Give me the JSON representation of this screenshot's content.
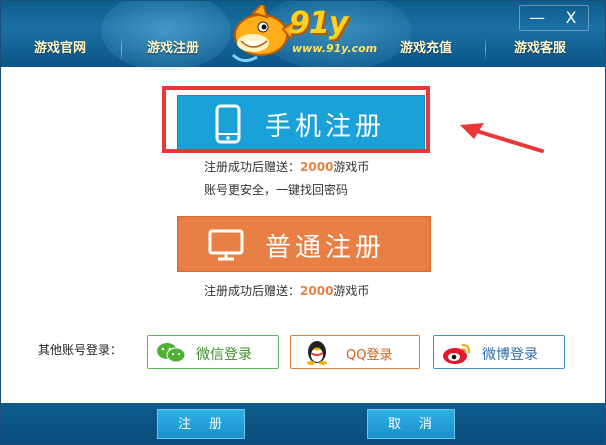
{
  "nav": {
    "items": [
      "游戏官网",
      "游戏注册",
      "游戏充值",
      "游戏客服"
    ]
  },
  "logo": {
    "text": "91y",
    "url": "www.91y.com"
  },
  "window": {
    "minimize": "—",
    "close": "X"
  },
  "register_phone": {
    "label": "手机注册",
    "icon": "smartphone-icon"
  },
  "register_normal": {
    "label": "普通注册",
    "icon": "monitor-icon"
  },
  "notes": {
    "phone_bonus_prefix": "注册成功后赠送：",
    "phone_bonus_amount": "2000",
    "phone_bonus_suffix": "游戏币",
    "phone_security": "账号更安全，一键找回密码",
    "normal_bonus_prefix": "注册成功后赠送：",
    "normal_bonus_amount": "2000",
    "normal_bonus_suffix": "游戏币"
  },
  "other_login": {
    "label": "其他账号登录：",
    "wechat": "微信登录",
    "qq": "QQ登录",
    "weibo": "微博登录"
  },
  "footer": {
    "register": "注册",
    "cancel": "取消"
  },
  "colors": {
    "phone_button": "#1aa1d7",
    "normal_button": "#e88045",
    "highlight": "#ea3636",
    "header": "#0e5c8c"
  }
}
